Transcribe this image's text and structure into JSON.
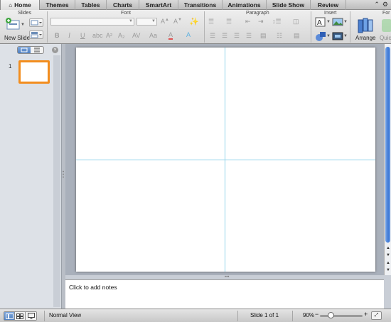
{
  "tabs": [
    {
      "label": "Home",
      "active": true
    },
    {
      "label": "Themes"
    },
    {
      "label": "Tables"
    },
    {
      "label": "Charts"
    },
    {
      "label": "SmartArt"
    },
    {
      "label": "Transitions"
    },
    {
      "label": "Animations"
    },
    {
      "label": "Slide Show"
    },
    {
      "label": "Review"
    }
  ],
  "ribbon": {
    "groups": {
      "slides": "Slides",
      "font": "Font",
      "paragraph": "Paragraph",
      "insert": "Insert",
      "format": "For"
    },
    "new_slide": "New Slide",
    "arrange": "Arrange",
    "quick_styles": "Quic"
  },
  "left_pane": {
    "slide_number": "1"
  },
  "notes": {
    "placeholder": "Click to add notes"
  },
  "status_bar": {
    "view_name": "Normal View",
    "slide_counter": "Slide 1 of 1",
    "zoom": "90%",
    "zoom_fraction": 0.25
  },
  "colors": {
    "thumb_border": "#f28d1e",
    "guide": "#8fd3ea",
    "scroll_thumb": "#3e78d6"
  }
}
